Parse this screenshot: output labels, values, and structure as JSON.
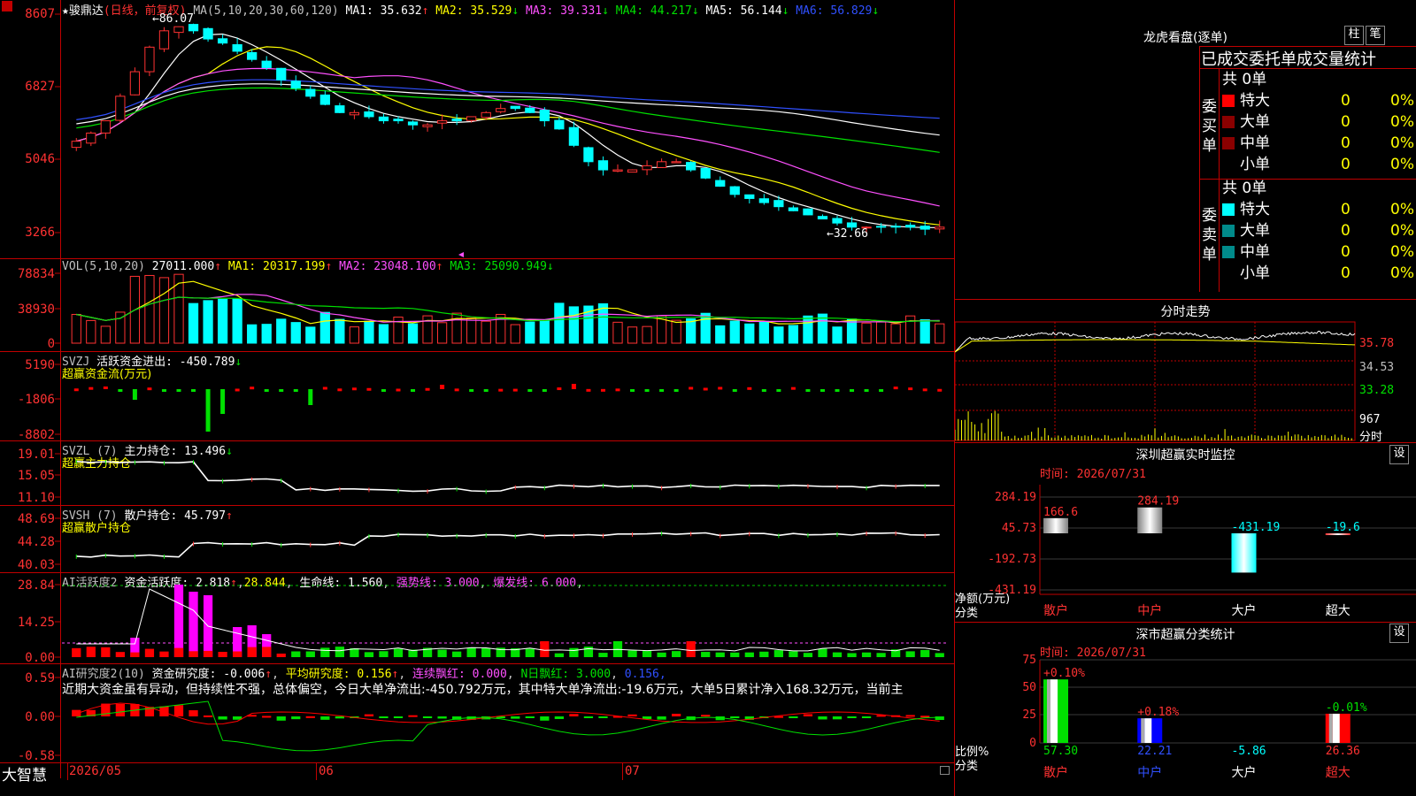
{
  "stock": {
    "star": "★",
    "name": "骏鼎达",
    "period": "(日线，前复权)"
  },
  "main": {
    "ma_label": "MA(5,10,20,30,60,120)",
    "ma": [
      {
        "name": "MA1:",
        "val": "35.632",
        "arrow": "↑",
        "color": "#ffffff"
      },
      {
        "name": "MA2:",
        "val": "35.529",
        "arrow": "↓",
        "color": "#ffff00"
      },
      {
        "name": "MA3:",
        "val": "39.331",
        "arrow": "↓",
        "color": "#ff50ff"
      },
      {
        "name": "MA4:",
        "val": "44.217",
        "arrow": "↓",
        "color": "#00e000"
      },
      {
        "name": "MA5:",
        "val": "56.144",
        "arrow": "↓",
        "color": "#ffffff"
      },
      {
        "name": "MA6:",
        "val": "56.829",
        "arrow": "↓",
        "color": "#3050ff"
      }
    ],
    "y_ticks": [
      "8607",
      "6827",
      "5046",
      "3266"
    ],
    "high_label": "←86.07",
    "low_label": "←32.66",
    "marker_icon": "pin-icon"
  },
  "vol": {
    "label": "VOL(5,10,20)",
    "val": "27011.000",
    "arrow": "↑",
    "ma": [
      {
        "name": "MA1:",
        "val": "20317.199",
        "arrow": "↑",
        "color": "#ffff00"
      },
      {
        "name": "MA2:",
        "val": "23048.100",
        "arrow": "↑",
        "color": "#ff50ff"
      },
      {
        "name": "MA3:",
        "val": "25090.949",
        "arrow": "↓",
        "color": "#00e000"
      }
    ],
    "y_ticks": [
      "78834",
      "38930",
      "0"
    ]
  },
  "svzj": {
    "label": "SVZJ",
    "name": "活跃资金进出:",
    "val": "-450.789",
    "arrow": "↓",
    "sub": "超赢资金流(万元)",
    "y_ticks": [
      "5190",
      "-1806",
      "-8802"
    ]
  },
  "svzl": {
    "label": "SVZL (7)",
    "name": "主力持仓:",
    "val": "13.496",
    "arrow": "↓",
    "sub": "超赢主力持仓",
    "y_ticks": [
      "19.01",
      "15.05",
      "11.10"
    ]
  },
  "svsh": {
    "label": "SVSH (7)",
    "name": "散户持仓:",
    "val": "45.797",
    "arrow": "↑",
    "sub": "超赢散户持仓",
    "y_ticks": [
      "48.69",
      "44.28",
      "40.03"
    ]
  },
  "ai1": {
    "label": "AI活跃度2",
    "a_name": "资金活跃度:",
    "a_val": "2.818",
    "a_arrow": "↑",
    "b_val": "28.844",
    "c_name": "生命线:",
    "c_val": "1.560",
    "d_name": "强势线:",
    "d_val": "3.000",
    "e_name": "爆发线:",
    "e_val": "6.000",
    "y_ticks": [
      "28.84",
      "14.25",
      "0.00"
    ]
  },
  "ai2": {
    "label": "AI研究度2(10)",
    "a_name": "资金研究度:",
    "a_val": "-0.006",
    "a_arrow": "↑",
    "b_name": "平均研究度:",
    "b_val": "0.156",
    "b_arrow": "↑",
    "c_name": "连续飘红:",
    "c_val": "0.000",
    "d_name": "N日飘红:",
    "d_val": "3.000",
    "e_val": "0.156",
    "note": "近期大资金虽有异动，但持续性不强，总体偏空，今日大单净流出:-450.792万元，其中特大单净流出:-19.6万元，大单5日累计净入168.32万元，当前主",
    "y_ticks": [
      "0.59",
      "0.00",
      "-0.58"
    ]
  },
  "xaxis": {
    "logo": "大智慧",
    "labels": [
      "2026/05",
      "06",
      "07"
    ]
  },
  "dragon": {
    "title": "龙虎看盘(逐单)",
    "btn1": "柱",
    "btn2": "笔",
    "subtitle": "已成交委托单成交量统计",
    "buy_label": "委买单",
    "sell_label": "委卖单",
    "buy_total": "共 0单",
    "sell_total": "共 0单",
    "buy_rows": [
      {
        "name": "特大",
        "v": "0",
        "p": "0%",
        "c": "#ff0000"
      },
      {
        "name": "大单",
        "v": "0",
        "p": "0%",
        "c": "#8b0000"
      },
      {
        "name": "中单",
        "v": "0",
        "p": "0%",
        "c": "#8b0000"
      },
      {
        "name": "小单",
        "v": "0",
        "p": "0%",
        "c": "#000000"
      }
    ],
    "sell_rows": [
      {
        "name": "特大",
        "v": "0",
        "p": "0%",
        "c": "#00ffff"
      },
      {
        "name": "大单",
        "v": "0",
        "p": "0%",
        "c": "#008b8b"
      },
      {
        "name": "中单",
        "v": "0",
        "p": "0%",
        "c": "#008b8b"
      },
      {
        "name": "小单",
        "v": "0",
        "p": "0%",
        "c": "#000000"
      }
    ]
  },
  "intraday": {
    "title": "分时走势",
    "y_ticks": [
      "35.78",
      "34.53",
      "33.28"
    ],
    "vol_tick": "967",
    "vol_label": "分时"
  },
  "monitor": {
    "title": "深圳超赢实时监控",
    "btn": "设",
    "time": "时间: 2026/07/31",
    "y_ticks": [
      "284.19",
      "45.73",
      "-192.73",
      "-431.19"
    ],
    "ylabel": "净额(万元)",
    "xlabel": "分类",
    "cats": [
      "散户",
      "中户",
      "大户",
      "超大"
    ],
    "values": [
      166.6,
      284.19,
      -431.19,
      -19.6
    ],
    "labels": [
      "166.6",
      "284.19",
      "-431.19",
      "-19.6"
    ]
  },
  "classify": {
    "title": "深市超赢分类统计",
    "btn": "设",
    "time": "时间: 2026/07/31",
    "y_ticks": [
      "75",
      "50",
      "25",
      "0"
    ],
    "ylabel": "比例%",
    "xlabel": "分类",
    "cats": [
      "散户",
      "中户",
      "大户",
      "超大"
    ],
    "values": [
      57.3,
      22.21,
      -5.86,
      26.36
    ],
    "labels": [
      "57.30",
      "22.21",
      "-5.86",
      "26.36"
    ],
    "top_labels": [
      "+0.10%",
      "+0.18%",
      "",
      "-0.01%"
    ]
  },
  "colors": {
    "up": "#ff3232",
    "down": "#00ffff",
    "grid": "#c00000"
  }
}
